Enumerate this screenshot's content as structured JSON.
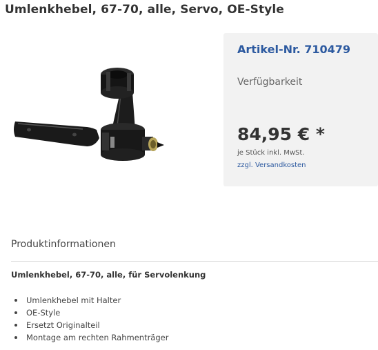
{
  "product": {
    "title": "Umlenkhebel, 67-70, alle, Servo, OE-Style",
    "image_name": "steering-idler-arm-image"
  },
  "buybox": {
    "article_number": "Artikel-Nr. 710479",
    "availability": "Verfügbarkeit",
    "price": "84,95 € *",
    "vat_note": "je Stück inkl. MwSt.",
    "shipping_link": "zzgl. Versandkosten"
  },
  "info": {
    "heading": "Produktinformationen",
    "subtitle": "Umlenkhebel, 67-70, alle, für Servolenkung",
    "features": [
      "Umlenkhebel mit Halter",
      "OE-Style",
      "Ersetzt Originalteil",
      "Montage am rechten Rahmenträger"
    ]
  },
  "colors": {
    "accent_blue": "#2d5aa0",
    "buybox_bg": "#f2f2f2",
    "text_dark": "#333333"
  }
}
